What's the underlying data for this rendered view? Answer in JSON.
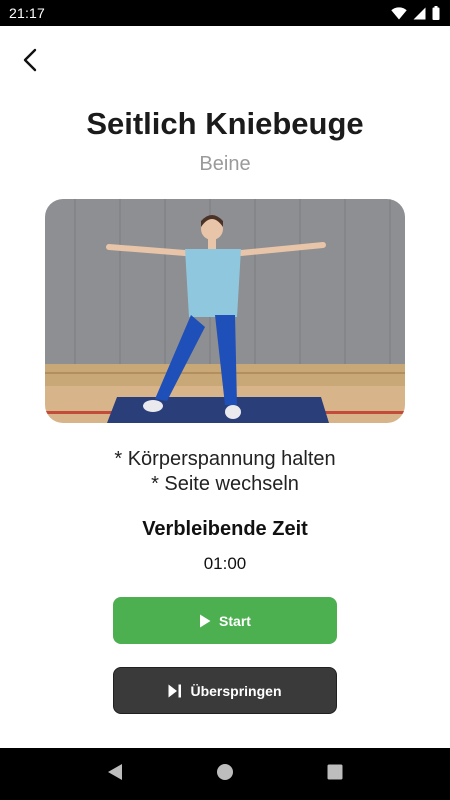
{
  "status_bar": {
    "time": "21:17",
    "icons": [
      "wifi-icon",
      "signal-icon",
      "battery-icon"
    ]
  },
  "header": {
    "back_icon": "chevron-left-icon"
  },
  "exercise": {
    "title": "Seitlich Kniebeuge",
    "category": "Beine",
    "instructions": [
      "* Körperspannung halten",
      "* Seite wechseln"
    ]
  },
  "timer": {
    "label": "Verbleibende Zeit",
    "value": "01:00"
  },
  "buttons": {
    "start_label": "Start",
    "start_icon": "play-icon",
    "skip_label": "Überspringen",
    "skip_icon": "skip-next-icon"
  },
  "colors": {
    "start_button": "#4caf50",
    "skip_button": "#3a3a3a",
    "subtitle": "#9a9a9a"
  },
  "nav_bar": {
    "icons": [
      "back-triangle-icon",
      "home-circle-icon",
      "recents-square-icon"
    ]
  }
}
